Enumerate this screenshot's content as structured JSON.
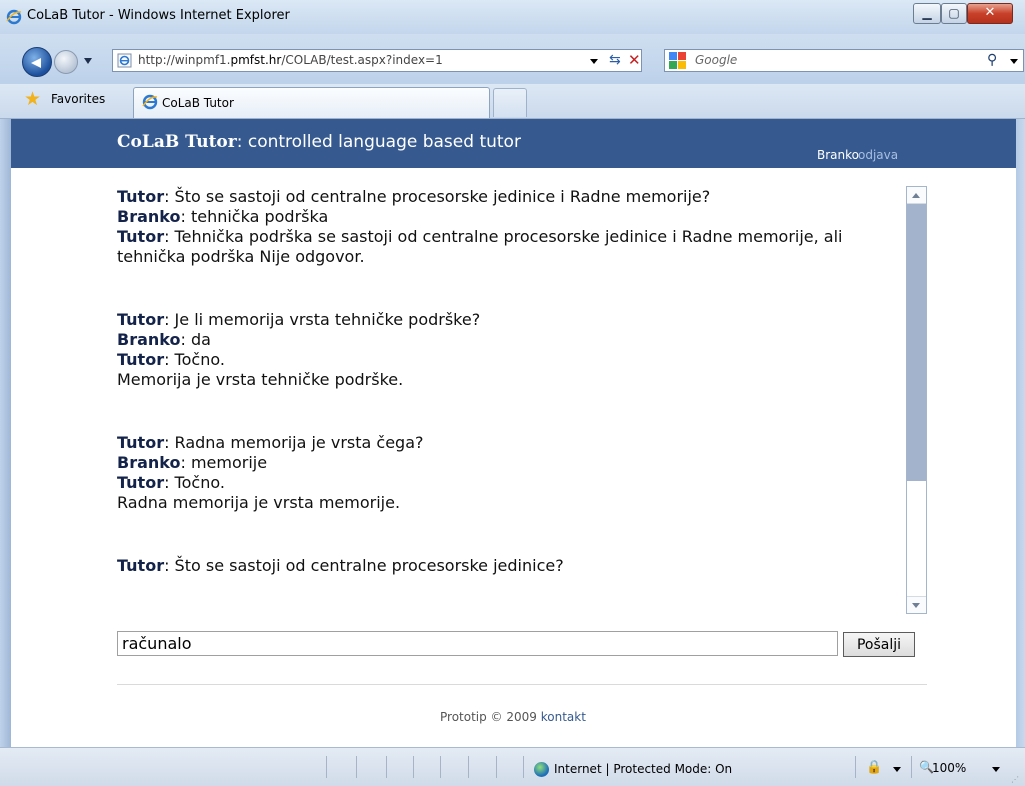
{
  "window": {
    "title": "CoLaB Tutor - Windows Internet Explorer"
  },
  "address_bar": {
    "url_prefix": "http://winpmf1.",
    "url_domain": "pmfst.hr",
    "url_path": "/COLAB/test.aspx?index=1",
    "icons": [
      "ie-page-icon",
      "dropdown-icon",
      "refresh-icon",
      "stop-icon"
    ]
  },
  "search_bar": {
    "placeholder": "Google",
    "icons": [
      "google-logo",
      "search-icon"
    ]
  },
  "favorites_bar": {
    "favorites_label": "Favorites"
  },
  "tabs": [
    {
      "label": "CoLaB Tutor",
      "active": true
    }
  ],
  "header": {
    "site_name": "CoLaB Tutor",
    "tagline": ": controlled language based tutor",
    "user": "Branko",
    "logout_label": "odjava",
    "bg_color": "#365a8f"
  },
  "chat": {
    "blocks": [
      {
        "lines": [
          {
            "speaker": "Tutor",
            "text": ": Što se sastoji od centralne procesorske jedinice i Radne memorije?"
          },
          {
            "speaker": "Branko",
            "text": ": tehnička podrška"
          },
          {
            "speaker": "Tutor",
            "text": ": Tehnička podrška se sastoji od centralne procesorske jedinice i Radne memorije, ali tehnička podrška Nije odgovor."
          }
        ]
      },
      {
        "lines": [
          {
            "speaker": "Tutor",
            "text": ": Je li memorija vrsta tehničke podrške?"
          },
          {
            "speaker": "Branko",
            "text": ": da"
          },
          {
            "speaker": "Tutor",
            "text": ": Točno."
          },
          {
            "speaker": "",
            "text": "Memorija je vrsta tehničke podrške."
          }
        ]
      },
      {
        "lines": [
          {
            "speaker": "Tutor",
            "text": ": Radna memorija je vrsta čega?"
          },
          {
            "speaker": "Branko",
            "text": ": memorije"
          },
          {
            "speaker": "Tutor",
            "text": ": Točno."
          },
          {
            "speaker": "",
            "text": "Radna memorija je vrsta memorije."
          }
        ]
      },
      {
        "lines": [
          {
            "speaker": "Tutor",
            "text": ": Što se sastoji od centralne procesorske jedinice?"
          }
        ]
      }
    ]
  },
  "answer": {
    "value": "računalo",
    "send_label": "Pošalji"
  },
  "footer": {
    "text": "Prototip © 2009 ",
    "link_label": "kontakt"
  },
  "status_bar": {
    "zone": "Internet | Protected Mode: On",
    "zoom": "100%"
  }
}
